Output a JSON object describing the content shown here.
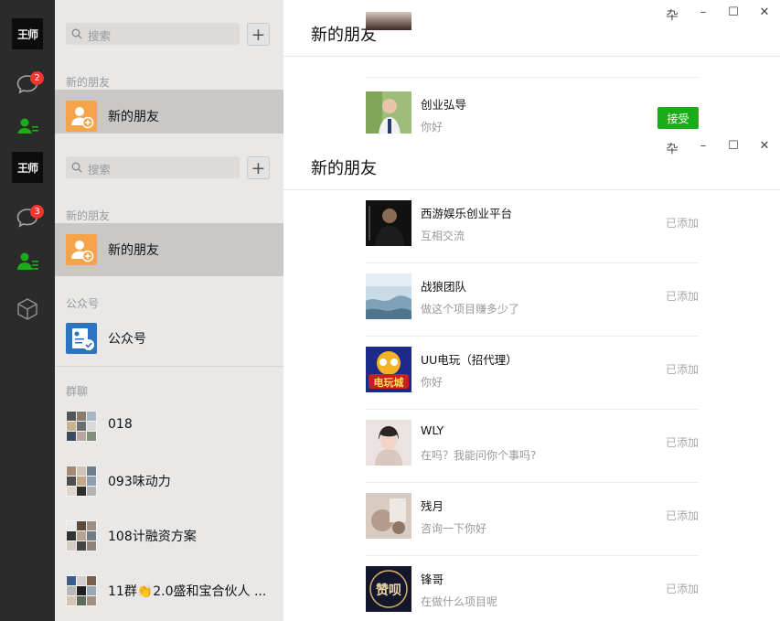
{
  "profile": {
    "avatar_text": "王师"
  },
  "nav": {
    "chat_badge_back": "2",
    "chat_badge_front": "3"
  },
  "search": {
    "placeholder": "搜索"
  },
  "sections": {
    "new_friends": "新的朋友",
    "official": "公众号",
    "groups": "群聊"
  },
  "contacts": {
    "new_friends_label": "新的朋友",
    "official_label": "公众号",
    "groups": [
      {
        "name": "018"
      },
      {
        "name": "093味动力"
      },
      {
        "name": "108计融资方案"
      },
      {
        "name": "11群👏2.0盛和宝合伙人 ..."
      }
    ]
  },
  "main": {
    "title": "新的朋友"
  },
  "window": {
    "pin": "卆",
    "minimize": "–",
    "maximize": "☐",
    "close": "✕"
  },
  "back_requests": [
    {
      "name": "创业弘导",
      "message": "你好",
      "action": "接受"
    }
  ],
  "requests": [
    {
      "name": "西游娱乐创业平台",
      "message": "互相交流",
      "status": "已添加"
    },
    {
      "name": "战狼团队",
      "message": "做这个项目赚多少了",
      "status": "已添加"
    },
    {
      "name": "UU电玩（招代理）",
      "message": "你好",
      "status": "已添加"
    },
    {
      "name": "WLY",
      "message": "在吗？我能问你个事吗?",
      "status": "已添加"
    },
    {
      "name": "残月",
      "message": "咨询一下你好",
      "status": "已添加"
    },
    {
      "name": "锋哥",
      "message": "在做什么项目呢",
      "status": "已添加"
    }
  ],
  "thumb_text": {
    "uu": "电玩城",
    "zan": "赞呗"
  },
  "colors": {
    "accent_green": "#1aad19",
    "badge_red": "#f43530",
    "rail": "#2b2b2b"
  }
}
